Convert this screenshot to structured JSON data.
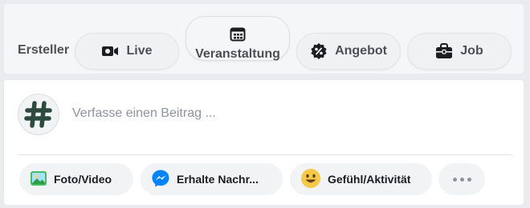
{
  "creator_bar": {
    "label": "Ersteller",
    "buttons": [
      {
        "label": "Live",
        "icon": "video-camera-icon"
      },
      {
        "label": "Veranstaltung",
        "icon": "calendar-icon"
      },
      {
        "label": "Angebot",
        "icon": "percent-badge-icon"
      },
      {
        "label": "Job",
        "icon": "briefcase-icon"
      }
    ]
  },
  "composer": {
    "avatar_symbol": "#",
    "placeholder": "Verfasse einen Beitrag ...",
    "actions": [
      {
        "label": "Foto/Video",
        "icon": "photo-icon"
      },
      {
        "label": "Erhalte Nachr...",
        "icon": "messenger-icon"
      },
      {
        "label": "Gefühl/Aktivität",
        "icon": "smiley-icon"
      },
      {
        "label": "",
        "icon": "more-dots-icon"
      }
    ]
  },
  "colors": {
    "background": "#e9ebee",
    "card": "#ffffff",
    "avatar_hash": "#2d4a3e",
    "messenger_blue": "#0084ff",
    "smiley_yellow": "#f7c948",
    "photo_green": "#45bd62"
  }
}
